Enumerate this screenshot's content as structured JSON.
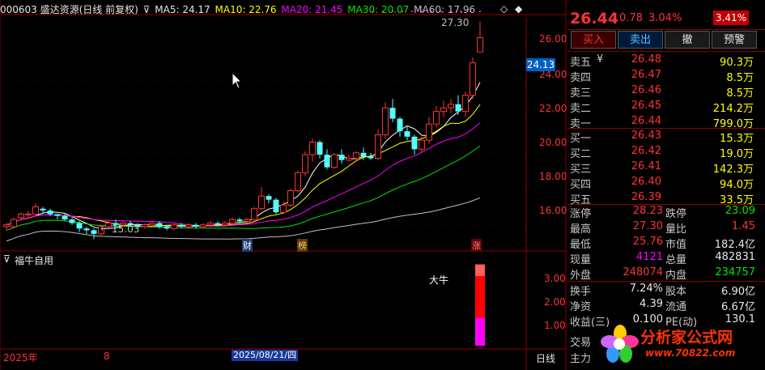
{
  "header": {
    "code_name": "000603 盛达资源(日线 前复权)",
    "ma5": "MA5: 24.17",
    "ma10": "MA10: 22.76",
    "ma20": "MA20: 21.45",
    "ma30": "MA30: 20.07",
    "ma60": "MA60: 17.96"
  },
  "colors": {
    "up": "#ff3232",
    "down": "#54ffff",
    "ma5": "#ffffff",
    "ma10": "#ffff00",
    "ma20": "#ff00ff",
    "ma30": "#00e600",
    "ma60": "#c0c0c0"
  },
  "price_axis": [
    "26.00",
    "24.00",
    "22.00",
    "20.00",
    "18.00",
    "16.00"
  ],
  "current_price_marker": "24.13",
  "annotations": {
    "high": "27.30",
    "low": "15.03"
  },
  "event_markers": [
    "财",
    "榜",
    "涨"
  ],
  "indicator": {
    "title": "福牛自用",
    "axis": [
      "3.00",
      "2.00",
      "1.00"
    ],
    "signal_label": "大牛"
  },
  "timeline": {
    "year": "2025年",
    "month": "8",
    "cursor_date": "2025/08/21/四",
    "period": "日线"
  },
  "stock": {
    "name": "盛达资源",
    "price": "26.44",
    "change": "0.78",
    "change_pct": "3.04%",
    "badge": "3.41%"
  },
  "trade_buttons": {
    "buy": "买入",
    "sell": "卖出",
    "cancel": "撤",
    "alert": "预警"
  },
  "asks": [
    {
      "label": "卖五",
      "price": "26.48",
      "vol": "90.3万"
    },
    {
      "label": "卖四",
      "price": "26.47",
      "vol": "8.5万"
    },
    {
      "label": "卖三",
      "price": "26.46",
      "vol": "8.5万"
    },
    {
      "label": "卖二",
      "price": "26.45",
      "vol": "214.2万"
    },
    {
      "label": "卖一",
      "price": "26.44",
      "vol": "799.0万"
    }
  ],
  "ask_currency": "¥",
  "bids": [
    {
      "label": "买一",
      "price": "26.43",
      "vol": "15.3万"
    },
    {
      "label": "买二",
      "price": "26.42",
      "vol": "19.0万"
    },
    {
      "label": "买三",
      "price": "26.41",
      "vol": "142.3万"
    },
    {
      "label": "买四",
      "price": "26.40",
      "vol": "94.0万"
    },
    {
      "label": "买五",
      "price": "26.39",
      "vol": "33.5万"
    }
  ],
  "stats": [
    {
      "l1": "涨停",
      "v1": "28.23",
      "c1": "red",
      "l2": "跌停",
      "v2": "23.09",
      "c2": "grn"
    },
    {
      "l1": "最高",
      "v1": "27.30",
      "c1": "red",
      "l2": "量比",
      "v2": "1.45",
      "c2": "red"
    },
    {
      "l1": "最低",
      "v1": "25.76",
      "c1": "red",
      "l2": "市值",
      "v2": "182.4亿",
      "c2": "wht"
    },
    {
      "l1": "现量",
      "v1": "4121",
      "c1": "mag",
      "l2": "总量",
      "v2": "482831",
      "c2": "wht"
    },
    {
      "l1": "外盘",
      "v1": "248074",
      "c1": "red",
      "l2": "内盘",
      "v2": "234757",
      "c2": "grn"
    }
  ],
  "stats2": [
    {
      "l1": "换手",
      "v1": "7.24%",
      "c1": "wht",
      "l2": "股本",
      "v2": "6.90亿",
      "c2": "wht"
    },
    {
      "l1": "净资",
      "v1": "4.39",
      "c1": "wht",
      "l2": "流通",
      "v2": "6.67亿",
      "c2": "wht"
    },
    {
      "l1": "收益(三)",
      "v1": "0.100",
      "c1": "wht",
      "l2": "PE(动)",
      "v2": "130.1",
      "c2": "wht"
    }
  ],
  "bottom_labels": [
    "交易",
    "主力"
  ],
  "watermark": {
    "title": "分析家公式网",
    "url": "www.70822.com"
  },
  "chart_data": {
    "type": "candlestick",
    "price_range": [
      15,
      27.5
    ],
    "candles": [
      [
        15.9,
        16.0,
        15.7,
        16.1
      ],
      [
        15.9,
        16.3,
        15.8,
        16.4
      ],
      [
        16.4,
        16.6,
        16.3,
        16.7
      ],
      [
        16.6,
        16.6,
        16.4,
        16.8
      ],
      [
        16.6,
        17.0,
        16.5,
        17.2
      ],
      [
        16.9,
        16.8,
        16.6,
        17.0
      ],
      [
        16.8,
        16.6,
        16.5,
        16.9
      ],
      [
        16.6,
        16.5,
        16.3,
        16.6
      ],
      [
        16.5,
        16.3,
        16.2,
        16.6
      ],
      [
        16.3,
        16.1,
        16.0,
        16.4
      ],
      [
        16.1,
        15.8,
        15.6,
        16.2
      ],
      [
        15.8,
        15.7,
        15.5,
        15.9
      ],
      [
        15.7,
        15.5,
        15.2,
        15.8
      ],
      [
        15.5,
        15.9,
        15.4,
        16.0
      ],
      [
        15.9,
        16.1,
        15.8,
        16.2
      ],
      [
        16.1,
        16.0,
        15.9,
        16.3
      ],
      [
        16.0,
        16.1,
        15.9,
        16.2
      ],
      [
        16.1,
        16.0,
        15.9,
        16.2
      ],
      [
        16.0,
        15.9,
        15.8,
        16.1
      ],
      [
        15.9,
        16.0,
        15.8,
        16.1
      ],
      [
        16.0,
        16.1,
        15.9,
        16.2
      ],
      [
        16.1,
        15.9,
        15.8,
        16.2
      ],
      [
        15.9,
        15.8,
        15.7,
        16.0
      ],
      [
        15.8,
        16.0,
        15.7,
        16.1
      ],
      [
        16.0,
        15.9,
        15.8,
        16.1
      ],
      [
        15.9,
        16.0,
        15.8,
        16.1
      ],
      [
        16.0,
        15.9,
        15.8,
        16.1
      ],
      [
        15.9,
        16.0,
        15.8,
        16.1
      ],
      [
        16.0,
        16.1,
        15.9,
        16.2
      ],
      [
        16.1,
        16.0,
        15.9,
        16.2
      ],
      [
        16.0,
        16.1,
        15.9,
        16.2
      ],
      [
        16.1,
        16.3,
        16.0,
        16.4
      ],
      [
        16.3,
        16.2,
        16.1,
        16.4
      ],
      [
        16.2,
        16.3,
        16.1,
        16.4
      ],
      [
        16.3,
        16.9,
        16.2,
        17.0
      ],
      [
        16.9,
        17.6,
        16.8,
        18.1
      ],
      [
        17.6,
        17.4,
        17.2,
        17.7
      ],
      [
        17.4,
        16.7,
        16.6,
        17.5
      ],
      [
        16.7,
        17.1,
        16.6,
        17.3
      ],
      [
        17.1,
        17.9,
        17.0,
        18.0
      ],
      [
        17.9,
        18.9,
        17.8,
        19.0
      ],
      [
        18.9,
        19.9,
        18.7,
        20.1
      ],
      [
        19.9,
        20.6,
        19.5,
        20.8
      ],
      [
        20.6,
        19.9,
        19.7,
        20.7
      ],
      [
        19.9,
        19.2,
        19.1,
        20.2
      ],
      [
        19.2,
        19.9,
        19.1,
        20.0
      ],
      [
        19.9,
        19.6,
        19.4,
        20.2
      ],
      [
        19.6,
        19.7,
        19.5,
        19.9
      ],
      [
        19.7,
        20.0,
        19.5,
        20.1
      ],
      [
        20.0,
        19.8,
        19.6,
        20.3
      ],
      [
        19.8,
        19.7,
        19.6,
        20.0
      ],
      [
        19.7,
        21.0,
        19.6,
        21.3
      ],
      [
        21.0,
        22.5,
        20.8,
        22.8
      ],
      [
        22.5,
        21.9,
        21.7,
        23.0
      ],
      [
        21.9,
        21.2,
        20.9,
        22.0
      ],
      [
        21.2,
        20.9,
        20.7,
        21.5
      ],
      [
        20.9,
        20.2,
        19.9,
        21.0
      ],
      [
        20.2,
        20.7,
        20.0,
        20.9
      ],
      [
        20.7,
        21.6,
        20.5,
        22.0
      ],
      [
        21.6,
        22.3,
        21.4,
        22.6
      ],
      [
        22.3,
        22.5,
        22.0,
        22.9
      ],
      [
        22.5,
        22.7,
        22.2,
        23.0
      ],
      [
        22.7,
        22.3,
        22.1,
        23.2
      ],
      [
        22.3,
        23.2,
        22.0,
        23.4
      ],
      [
        23.2,
        25.0,
        23.0,
        25.3
      ],
      [
        25.6,
        26.4,
        25.8,
        27.3
      ]
    ],
    "ma_windows": [
      5,
      10,
      20,
      30,
      60
    ],
    "indicator_bars": [
      {
        "index": 65,
        "segments": [
          [
            0,
            1.2,
            "#ff00ff"
          ],
          [
            1.2,
            3.0,
            "#ff0000"
          ],
          [
            3.0,
            3.5,
            "#ff6060"
          ]
        ]
      }
    ]
  }
}
